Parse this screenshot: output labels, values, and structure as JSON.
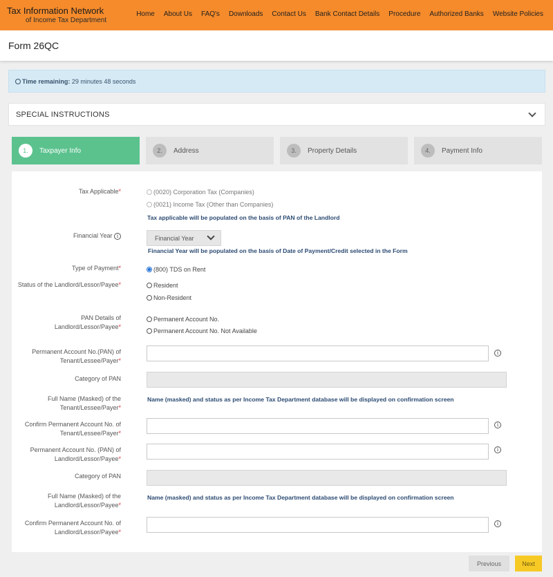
{
  "header": {
    "brand_title": "Tax Information Network",
    "brand_sub": "of Income Tax Department",
    "nav": [
      "Home",
      "About Us",
      "FAQ's",
      "Downloads",
      "Contact Us",
      "Bank Contact Details",
      "Procedure",
      "Authorized Banks",
      "Website Policies"
    ]
  },
  "page": {
    "title": "Form 26QC"
  },
  "timer": {
    "label": "Time remaining:",
    "value": "29 minutes 48 seconds"
  },
  "special": {
    "label": "SPECIAL INSTRUCTIONS"
  },
  "steps": [
    {
      "num": "1.",
      "label": "Taxpayer Info"
    },
    {
      "num": "2.",
      "label": "Address"
    },
    {
      "num": "3.",
      "label": "Property Details"
    },
    {
      "num": "4.",
      "label": "Payment Info"
    }
  ],
  "form": {
    "tax_applicable": {
      "label": "Tax Applicable",
      "opt1": "(0020) Corporation Tax (Companies)",
      "opt2": "(0021) Income Tax (Other than Companies)",
      "note": "Tax applicable will be populated on the basis of PAN of the Landlord"
    },
    "financial_year": {
      "label": "Financial Year",
      "placeholder": "Financial Year",
      "note": "Financial Year will be populated on the basis of Date of Payment/Credit selected in the Form"
    },
    "type_of_payment": {
      "label": "Type of Payment",
      "opt1": "(800) TDS on Rent"
    },
    "status": {
      "label": "Status of the Landlord/Lessor/Payee",
      "opt1": "Resident",
      "opt2": "Non-Resident"
    },
    "pan_details": {
      "label1": "PAN Details of",
      "label2": "Landlord/Lessor/Payee",
      "opt1": "Permanent Account No.",
      "opt2": "Permanent Account No. Not Available"
    },
    "pan_tenant": {
      "label1": "Permanent Account No.(PAN) of",
      "label2": "Tenant/Lessee/Payer"
    },
    "category_pan_1": {
      "label": "Category of PAN"
    },
    "full_name_tenant": {
      "label1": "Full Name (Masked) of the",
      "label2": "Tenant/Lessee/Payer",
      "note": "Name (masked) and status as per Income Tax Department database will be displayed on confirmation screen"
    },
    "confirm_pan_tenant": {
      "label1": "Confirm Permanent Account No. of",
      "label2": "Tenant/Lessee/Payer"
    },
    "pan_landlord": {
      "label1": "Permanent Account No. (PAN) of",
      "label2": "Landlord/Lessor/Payee"
    },
    "category_pan_2": {
      "label": "Category of PAN"
    },
    "full_name_landlord": {
      "label1": "Full Name (Masked) of the",
      "label2": "Landlord/Lessor/Payee",
      "note": "Name (masked) and status as per Income Tax Department database will be displayed on confirmation screen"
    },
    "confirm_pan_landlord": {
      "label1": "Confirm Permanent Account No. of",
      "label2": "Landlord/Lessor/Payee"
    }
  },
  "buttons": {
    "previous": "Previous",
    "next": "Next"
  }
}
